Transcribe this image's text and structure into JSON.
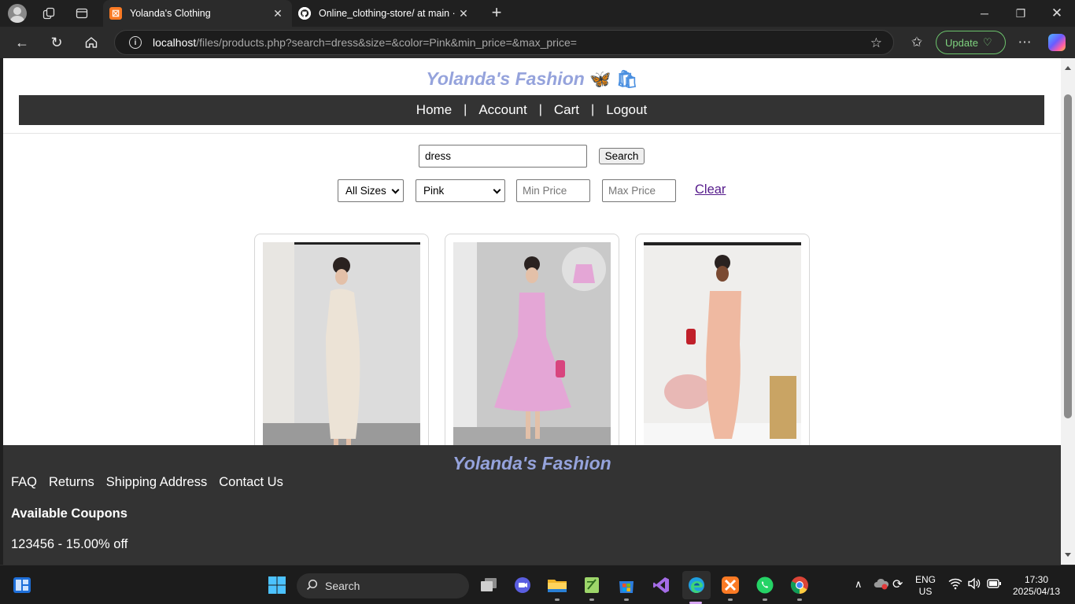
{
  "browser": {
    "tabs": [
      {
        "title": "Yolanda's Clothing",
        "active": true
      },
      {
        "title": "Online_clothing-store/ at main · Y",
        "active": false
      }
    ],
    "url_host": "localhost",
    "url_path": "/files/products.php?search=dress&size=&color=Pink&min_price=&max_price=",
    "update_label": "Update"
  },
  "site": {
    "brand": "Yolanda's Fashion",
    "brand_emoji": "🦋 🛍",
    "nav": [
      "Home",
      "Account",
      "Cart",
      "Logout"
    ],
    "nav_sep": "|"
  },
  "filters": {
    "search_value": "dress",
    "search_button": "Search",
    "size_selected": "All Sizes",
    "color_selected": "Pink",
    "min_price_placeholder": "Min Price",
    "max_price_placeholder": "Max Price",
    "clear_label": "Clear"
  },
  "products": [
    {
      "color": "#ece3d6"
    },
    {
      "color": "#e4a6d6"
    },
    {
      "color": "#efb9a1"
    }
  ],
  "footer": {
    "brand": "Yolanda's Fashion",
    "links": [
      "FAQ",
      "Returns",
      "Shipping Address",
      "Contact Us"
    ],
    "coupons_title": "Available Coupons",
    "coupons": [
      "123456 - 15.00% off"
    ]
  },
  "taskbar": {
    "search_label": "Search",
    "lang_line1": "ENG",
    "lang_line2": "US",
    "time": "17:30",
    "date": "2025/04/13"
  }
}
